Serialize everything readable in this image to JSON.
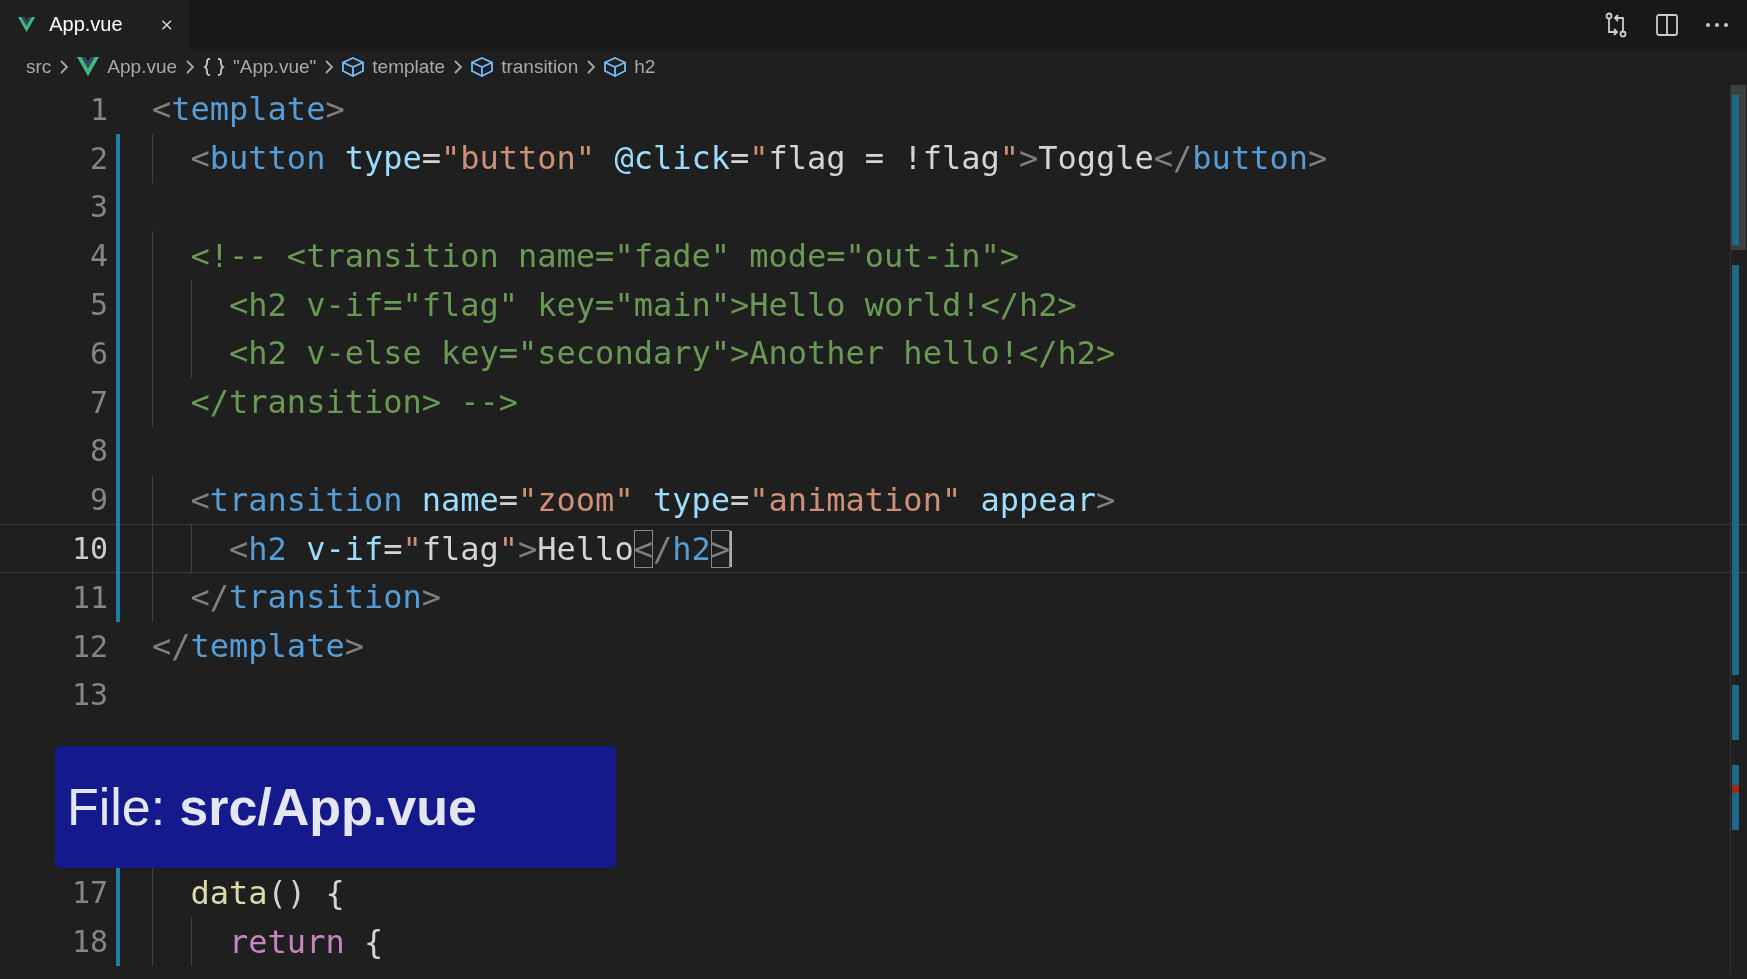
{
  "tab": {
    "label": "App.vue",
    "selected": true
  },
  "breadcrumbs": [
    {
      "kind": "folder",
      "label": "src"
    },
    {
      "kind": "vue",
      "label": "App.vue"
    },
    {
      "kind": "braces",
      "label": "\"App.vue\""
    },
    {
      "kind": "element",
      "label": "template"
    },
    {
      "kind": "element",
      "label": "transition"
    },
    {
      "kind": "element",
      "label": "h2"
    }
  ],
  "lines": [
    {
      "number": "1",
      "modified": false,
      "current": false,
      "tokens": [
        {
          "kind": "punct",
          "text": "<"
        },
        {
          "kind": "tag",
          "text": "template"
        },
        {
          "kind": "punct",
          "text": ">"
        }
      ]
    },
    {
      "number": "2",
      "modified": true,
      "current": false,
      "tokens": [
        {
          "kind": "punct",
          "text": "  <"
        },
        {
          "kind": "tag",
          "text": "button"
        },
        {
          "kind": "attr",
          "text": " type"
        },
        {
          "kind": "text",
          "text": "="
        },
        {
          "kind": "string",
          "text": "\"button\""
        },
        {
          "kind": "attr",
          "text": " @click"
        },
        {
          "kind": "text",
          "text": "="
        },
        {
          "kind": "string",
          "text": "\""
        },
        {
          "kind": "text",
          "text": "flag = !flag"
        },
        {
          "kind": "string",
          "text": "\""
        },
        {
          "kind": "punct",
          "text": ">"
        },
        {
          "kind": "text",
          "text": "Toggle"
        },
        {
          "kind": "punct",
          "text": "</"
        },
        {
          "kind": "tag",
          "text": "button"
        },
        {
          "kind": "punct",
          "text": ">"
        }
      ]
    },
    {
      "number": "3",
      "modified": true,
      "current": false
    },
    {
      "number": "4",
      "modified": true,
      "current": false,
      "tokens": [
        {
          "kind": "comment",
          "text": "  <!-- <transition name=\"fade\" mode=\"out-in\">"
        }
      ]
    },
    {
      "number": "5",
      "modified": true,
      "current": false,
      "tokens": [
        {
          "kind": "comment",
          "text": "    <h2 v-if=\"flag\" key=\"main\">Hello world!</h2>"
        }
      ]
    },
    {
      "number": "6",
      "modified": true,
      "current": false,
      "tokens": [
        {
          "kind": "comment",
          "text": "    <h2 v-else key=\"secondary\">Another hello!</h2>"
        }
      ]
    },
    {
      "number": "7",
      "modified": true,
      "current": false,
      "tokens": [
        {
          "kind": "comment",
          "text": "  </transition> -->"
        }
      ]
    },
    {
      "number": "8",
      "modified": true,
      "current": false
    },
    {
      "number": "9",
      "modified": true,
      "current": false,
      "tokens": [
        {
          "kind": "punct",
          "text": "  <"
        },
        {
          "kind": "tag",
          "text": "transition"
        },
        {
          "kind": "attr",
          "text": " name"
        },
        {
          "kind": "text",
          "text": "="
        },
        {
          "kind": "string",
          "text": "\"zoom\""
        },
        {
          "kind": "attr",
          "text": " type"
        },
        {
          "kind": "text",
          "text": "="
        },
        {
          "kind": "string",
          "text": "\"animation\""
        },
        {
          "kind": "attr",
          "text": " appear"
        },
        {
          "kind": "punct",
          "text": ">"
        }
      ]
    },
    {
      "number": "10",
      "modified": true,
      "current": true,
      "tokens": [
        {
          "kind": "punct",
          "text": "    <"
        },
        {
          "kind": "tag",
          "text": "h2"
        },
        {
          "kind": "attr",
          "text": " v-if"
        },
        {
          "kind": "text",
          "text": "="
        },
        {
          "kind": "string",
          "text": "\""
        },
        {
          "kind": "text",
          "text": "flag"
        },
        {
          "kind": "string",
          "text": "\""
        },
        {
          "kind": "punct",
          "text": ">"
        },
        {
          "kind": "text",
          "text": "Hello"
        },
        {
          "kind": "punct",
          "text": "<",
          "matched": true
        },
        {
          "kind": "punct",
          "text": "/"
        },
        {
          "kind": "tag",
          "text": "h2"
        },
        {
          "kind": "punct",
          "text": ">",
          "matched": true
        }
      ]
    },
    {
      "number": "11",
      "modified": true,
      "current": false,
      "tokens": [
        {
          "kind": "punct",
          "text": "  </"
        },
        {
          "kind": "tag",
          "text": "transition"
        },
        {
          "kind": "punct",
          "text": ">"
        }
      ]
    },
    {
      "number": "12",
      "modified": false,
      "current": false,
      "tokens": [
        {
          "kind": "punct",
          "text": "</"
        },
        {
          "kind": "tag",
          "text": "template"
        },
        {
          "kind": "punct",
          "text": ">"
        }
      ]
    },
    {
      "number": "13",
      "modified": false,
      "current": false
    }
  ],
  "caption": {
    "label": "File:",
    "path": "src/App.vue"
  },
  "lines_after": [
    {
      "number": "17",
      "modified": true,
      "current": false,
      "tokens": [
        {
          "kind": "func",
          "text": "  data"
        },
        {
          "kind": "text",
          "text": "() {"
        }
      ]
    },
    {
      "number": "18",
      "modified": true,
      "current": false,
      "tokens": [
        {
          "kind": "keyword",
          "text": "    return"
        },
        {
          "kind": "text",
          "text": " {"
        }
      ]
    }
  ]
}
